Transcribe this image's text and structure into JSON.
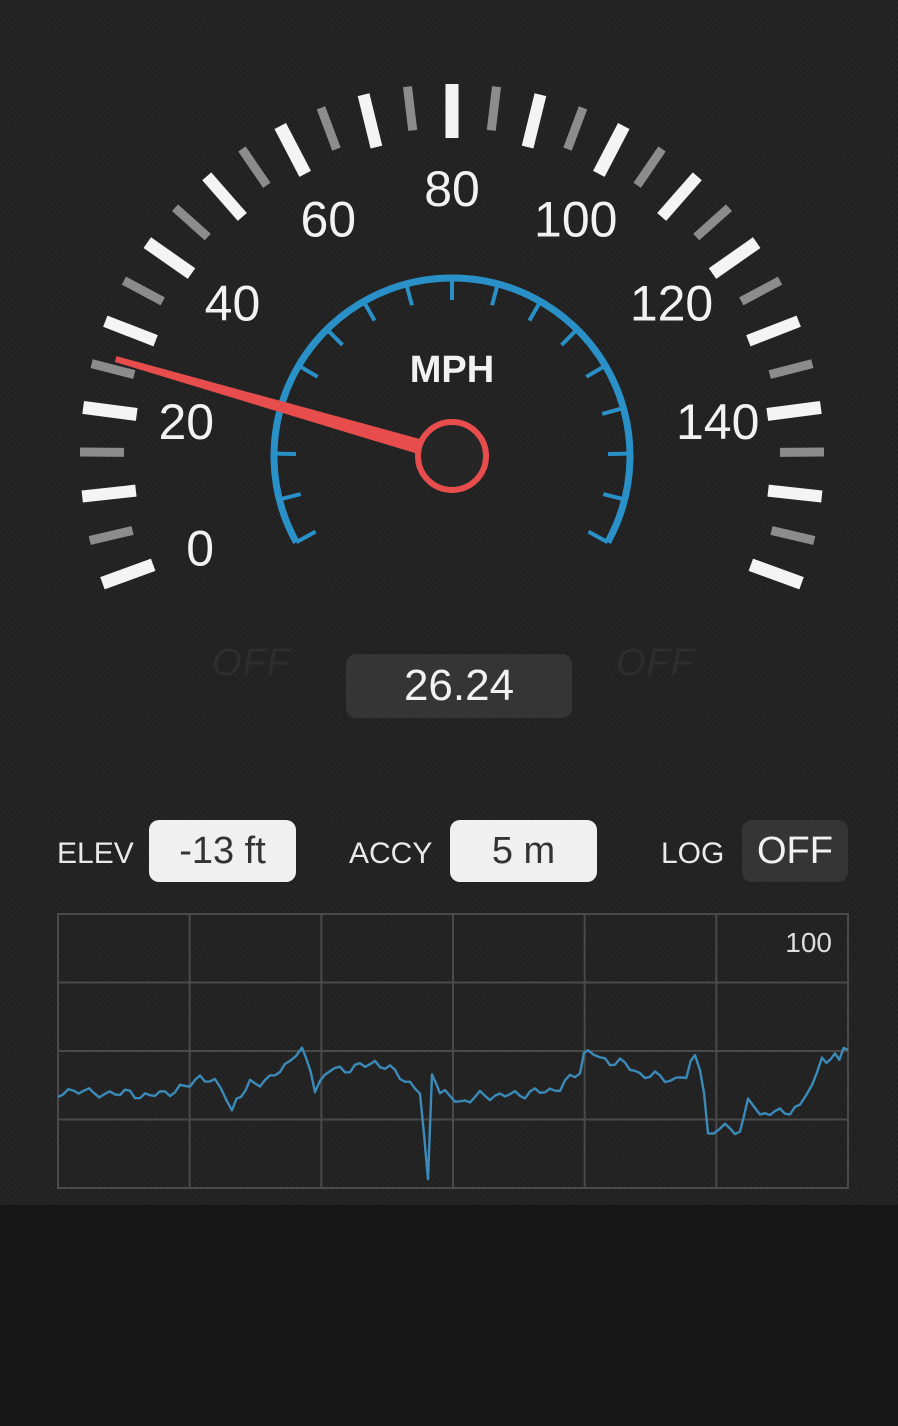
{
  "speedometer": {
    "unit": "MPH",
    "current_speed": 26.24,
    "current_speed_text": "26.24",
    "scale_labels": [
      "0",
      "20",
      "40",
      "60",
      "80",
      "100",
      "120",
      "140"
    ],
    "left_indicator": "OFF",
    "right_indicator": "OFF",
    "needle_color": "#e84d4d",
    "inner_arc_color": "#2a90c8"
  },
  "stats": {
    "elevation": {
      "label": "ELEV",
      "value": "-13 ft"
    },
    "accuracy": {
      "label": "ACCY",
      "value": "5 m"
    },
    "log": {
      "label": "LOG",
      "value": "OFF"
    }
  },
  "graph": {
    "max_label": "100",
    "line_color": "#3b8ab8",
    "grid": true
  }
}
